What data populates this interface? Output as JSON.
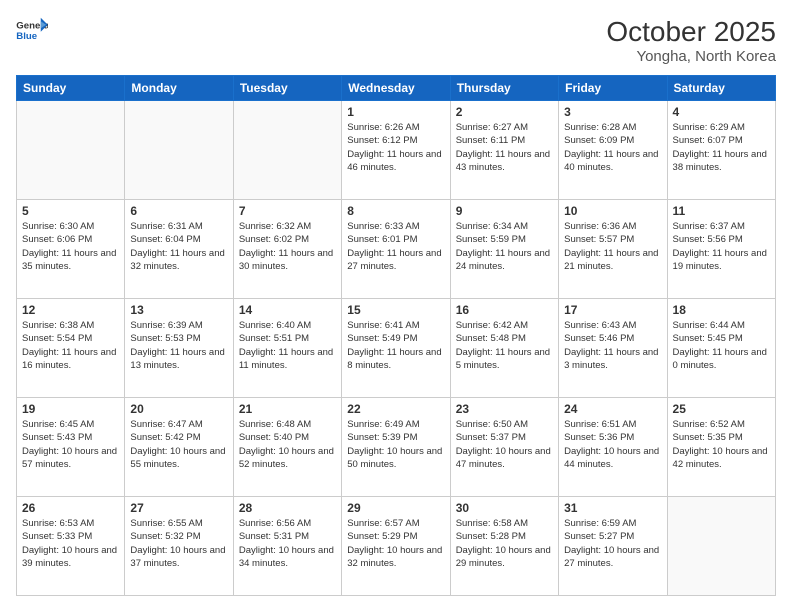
{
  "header": {
    "logo_general": "General",
    "logo_blue": "Blue",
    "title": "October 2025",
    "location": "Yongha, North Korea"
  },
  "weekdays": [
    "Sunday",
    "Monday",
    "Tuesday",
    "Wednesday",
    "Thursday",
    "Friday",
    "Saturday"
  ],
  "weeks": [
    [
      {
        "num": "",
        "detail": ""
      },
      {
        "num": "",
        "detail": ""
      },
      {
        "num": "",
        "detail": ""
      },
      {
        "num": "1",
        "detail": "Sunrise: 6:26 AM\nSunset: 6:12 PM\nDaylight: 11 hours\nand 46 minutes."
      },
      {
        "num": "2",
        "detail": "Sunrise: 6:27 AM\nSunset: 6:11 PM\nDaylight: 11 hours\nand 43 minutes."
      },
      {
        "num": "3",
        "detail": "Sunrise: 6:28 AM\nSunset: 6:09 PM\nDaylight: 11 hours\nand 40 minutes."
      },
      {
        "num": "4",
        "detail": "Sunrise: 6:29 AM\nSunset: 6:07 PM\nDaylight: 11 hours\nand 38 minutes."
      }
    ],
    [
      {
        "num": "5",
        "detail": "Sunrise: 6:30 AM\nSunset: 6:06 PM\nDaylight: 11 hours\nand 35 minutes."
      },
      {
        "num": "6",
        "detail": "Sunrise: 6:31 AM\nSunset: 6:04 PM\nDaylight: 11 hours\nand 32 minutes."
      },
      {
        "num": "7",
        "detail": "Sunrise: 6:32 AM\nSunset: 6:02 PM\nDaylight: 11 hours\nand 30 minutes."
      },
      {
        "num": "8",
        "detail": "Sunrise: 6:33 AM\nSunset: 6:01 PM\nDaylight: 11 hours\nand 27 minutes."
      },
      {
        "num": "9",
        "detail": "Sunrise: 6:34 AM\nSunset: 5:59 PM\nDaylight: 11 hours\nand 24 minutes."
      },
      {
        "num": "10",
        "detail": "Sunrise: 6:36 AM\nSunset: 5:57 PM\nDaylight: 11 hours\nand 21 minutes."
      },
      {
        "num": "11",
        "detail": "Sunrise: 6:37 AM\nSunset: 5:56 PM\nDaylight: 11 hours\nand 19 minutes."
      }
    ],
    [
      {
        "num": "12",
        "detail": "Sunrise: 6:38 AM\nSunset: 5:54 PM\nDaylight: 11 hours\nand 16 minutes."
      },
      {
        "num": "13",
        "detail": "Sunrise: 6:39 AM\nSunset: 5:53 PM\nDaylight: 11 hours\nand 13 minutes."
      },
      {
        "num": "14",
        "detail": "Sunrise: 6:40 AM\nSunset: 5:51 PM\nDaylight: 11 hours\nand 11 minutes."
      },
      {
        "num": "15",
        "detail": "Sunrise: 6:41 AM\nSunset: 5:49 PM\nDaylight: 11 hours\nand 8 minutes."
      },
      {
        "num": "16",
        "detail": "Sunrise: 6:42 AM\nSunset: 5:48 PM\nDaylight: 11 hours\nand 5 minutes."
      },
      {
        "num": "17",
        "detail": "Sunrise: 6:43 AM\nSunset: 5:46 PM\nDaylight: 11 hours\nand 3 minutes."
      },
      {
        "num": "18",
        "detail": "Sunrise: 6:44 AM\nSunset: 5:45 PM\nDaylight: 11 hours\nand 0 minutes."
      }
    ],
    [
      {
        "num": "19",
        "detail": "Sunrise: 6:45 AM\nSunset: 5:43 PM\nDaylight: 10 hours\nand 57 minutes."
      },
      {
        "num": "20",
        "detail": "Sunrise: 6:47 AM\nSunset: 5:42 PM\nDaylight: 10 hours\nand 55 minutes."
      },
      {
        "num": "21",
        "detail": "Sunrise: 6:48 AM\nSunset: 5:40 PM\nDaylight: 10 hours\nand 52 minutes."
      },
      {
        "num": "22",
        "detail": "Sunrise: 6:49 AM\nSunset: 5:39 PM\nDaylight: 10 hours\nand 50 minutes."
      },
      {
        "num": "23",
        "detail": "Sunrise: 6:50 AM\nSunset: 5:37 PM\nDaylight: 10 hours\nand 47 minutes."
      },
      {
        "num": "24",
        "detail": "Sunrise: 6:51 AM\nSunset: 5:36 PM\nDaylight: 10 hours\nand 44 minutes."
      },
      {
        "num": "25",
        "detail": "Sunrise: 6:52 AM\nSunset: 5:35 PM\nDaylight: 10 hours\nand 42 minutes."
      }
    ],
    [
      {
        "num": "26",
        "detail": "Sunrise: 6:53 AM\nSunset: 5:33 PM\nDaylight: 10 hours\nand 39 minutes."
      },
      {
        "num": "27",
        "detail": "Sunrise: 6:55 AM\nSunset: 5:32 PM\nDaylight: 10 hours\nand 37 minutes."
      },
      {
        "num": "28",
        "detail": "Sunrise: 6:56 AM\nSunset: 5:31 PM\nDaylight: 10 hours\nand 34 minutes."
      },
      {
        "num": "29",
        "detail": "Sunrise: 6:57 AM\nSunset: 5:29 PM\nDaylight: 10 hours\nand 32 minutes."
      },
      {
        "num": "30",
        "detail": "Sunrise: 6:58 AM\nSunset: 5:28 PM\nDaylight: 10 hours\nand 29 minutes."
      },
      {
        "num": "31",
        "detail": "Sunrise: 6:59 AM\nSunset: 5:27 PM\nDaylight: 10 hours\nand 27 minutes."
      },
      {
        "num": "",
        "detail": ""
      }
    ]
  ]
}
